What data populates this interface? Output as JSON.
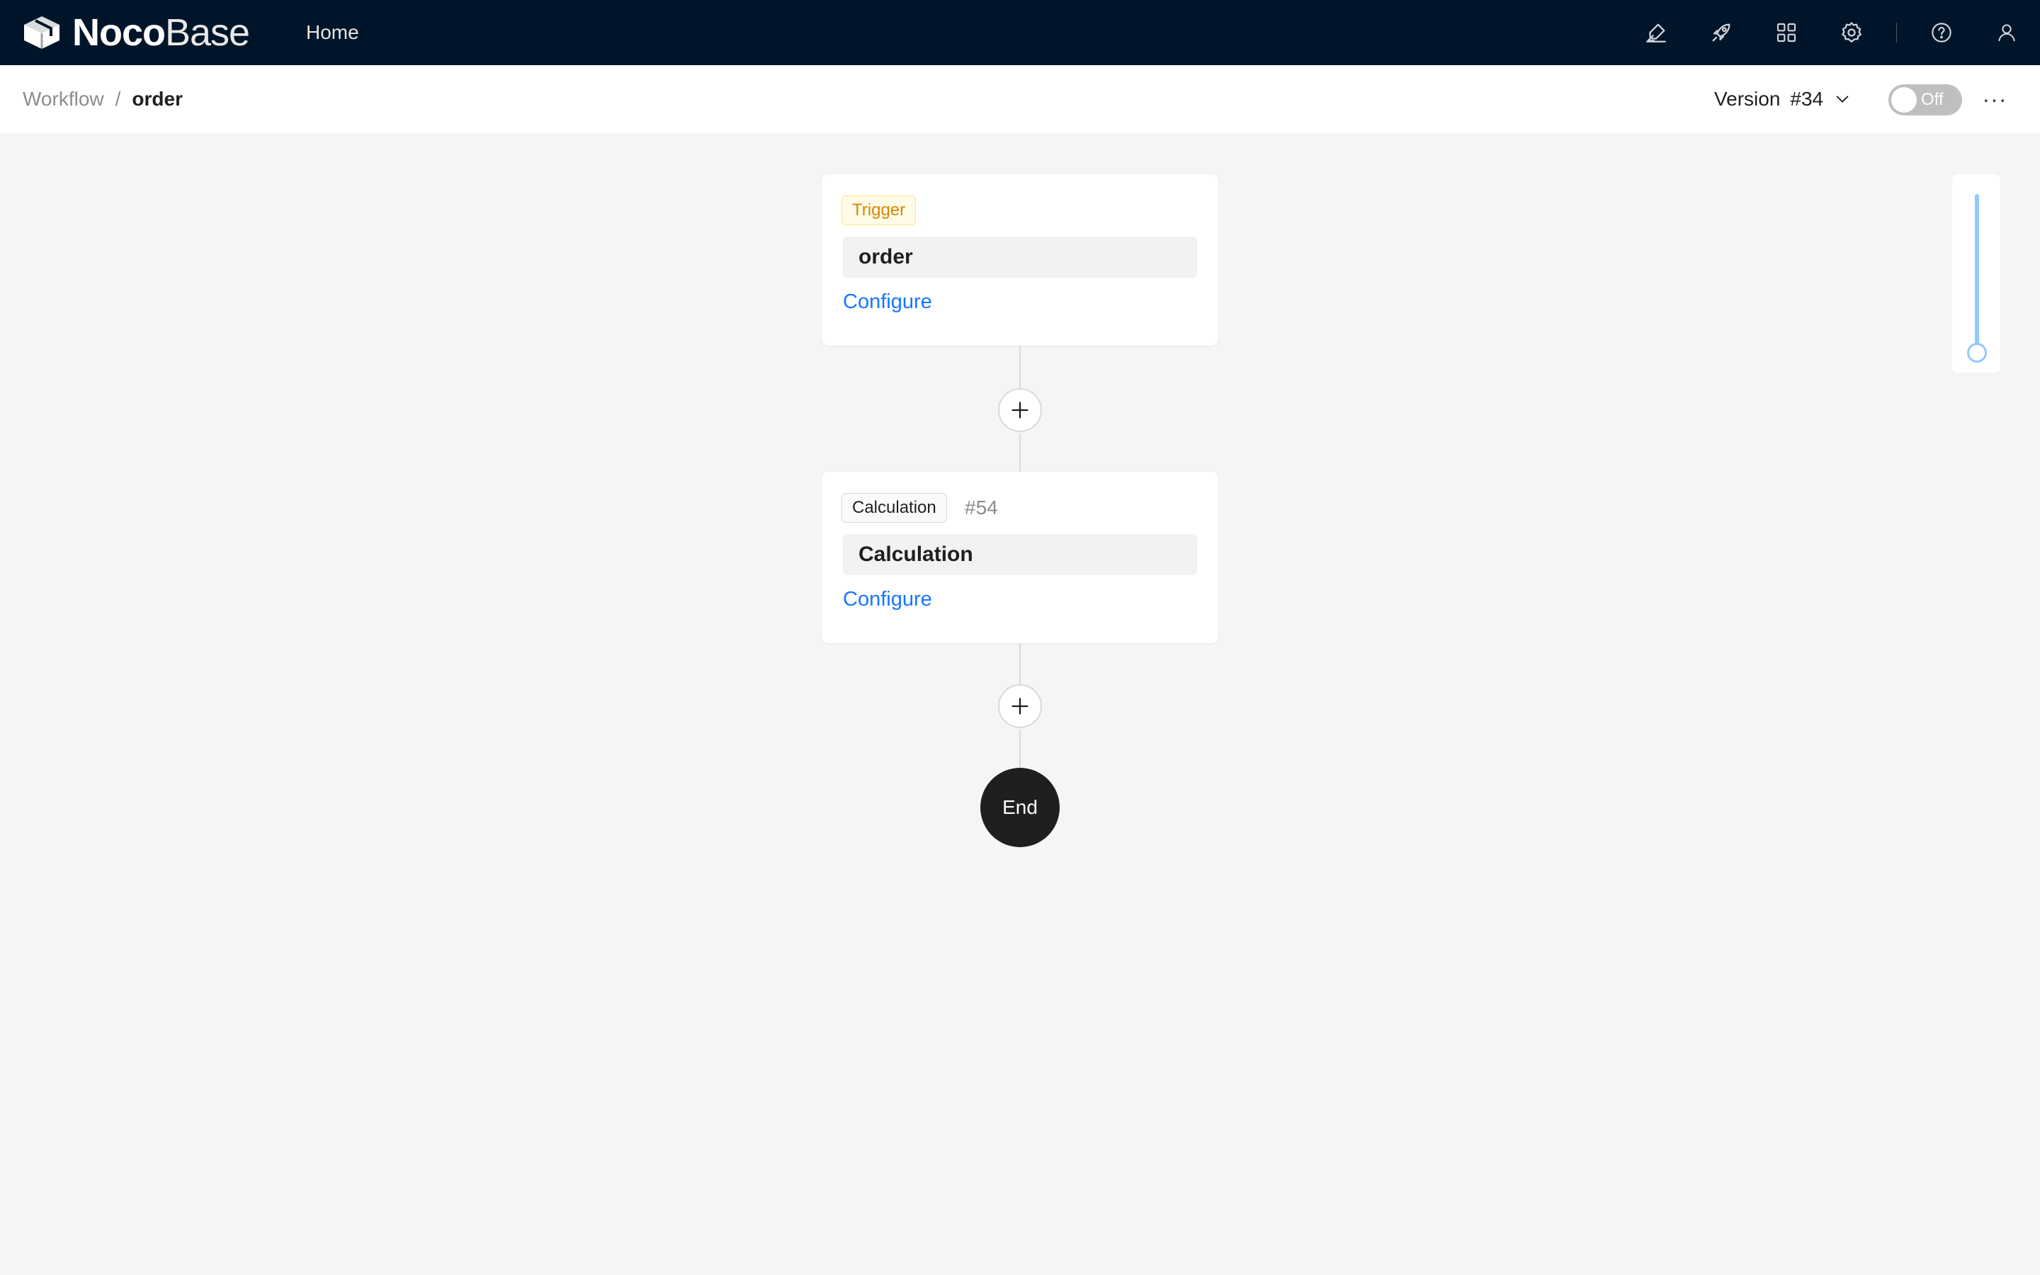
{
  "app": {
    "logo_bold": "Noco",
    "logo_light": "Base",
    "nav_home": "Home",
    "icons": [
      "highlight-icon",
      "rocket-icon",
      "apps-icon",
      "gear-icon",
      "help-icon",
      "user-icon"
    ],
    "colors": {
      "topbar": "#001529",
      "link": "#1677ff",
      "canvas": "#f5f5f5"
    }
  },
  "header": {
    "breadcrumb_parent": "Workflow",
    "breadcrumb_sep": "/",
    "breadcrumb_current": "order",
    "version_label": "Version",
    "version_value": "#34",
    "toggle_label": "Off",
    "more_label": "···"
  },
  "canvas": {
    "trigger_node": {
      "tag": "Trigger",
      "title": "order",
      "configure": "Configure"
    },
    "calc_node": {
      "tag": "Calculation",
      "id": "#54",
      "title": "Calculation",
      "configure": "Configure"
    },
    "end_label": "End",
    "zoom_level": 1.0
  }
}
